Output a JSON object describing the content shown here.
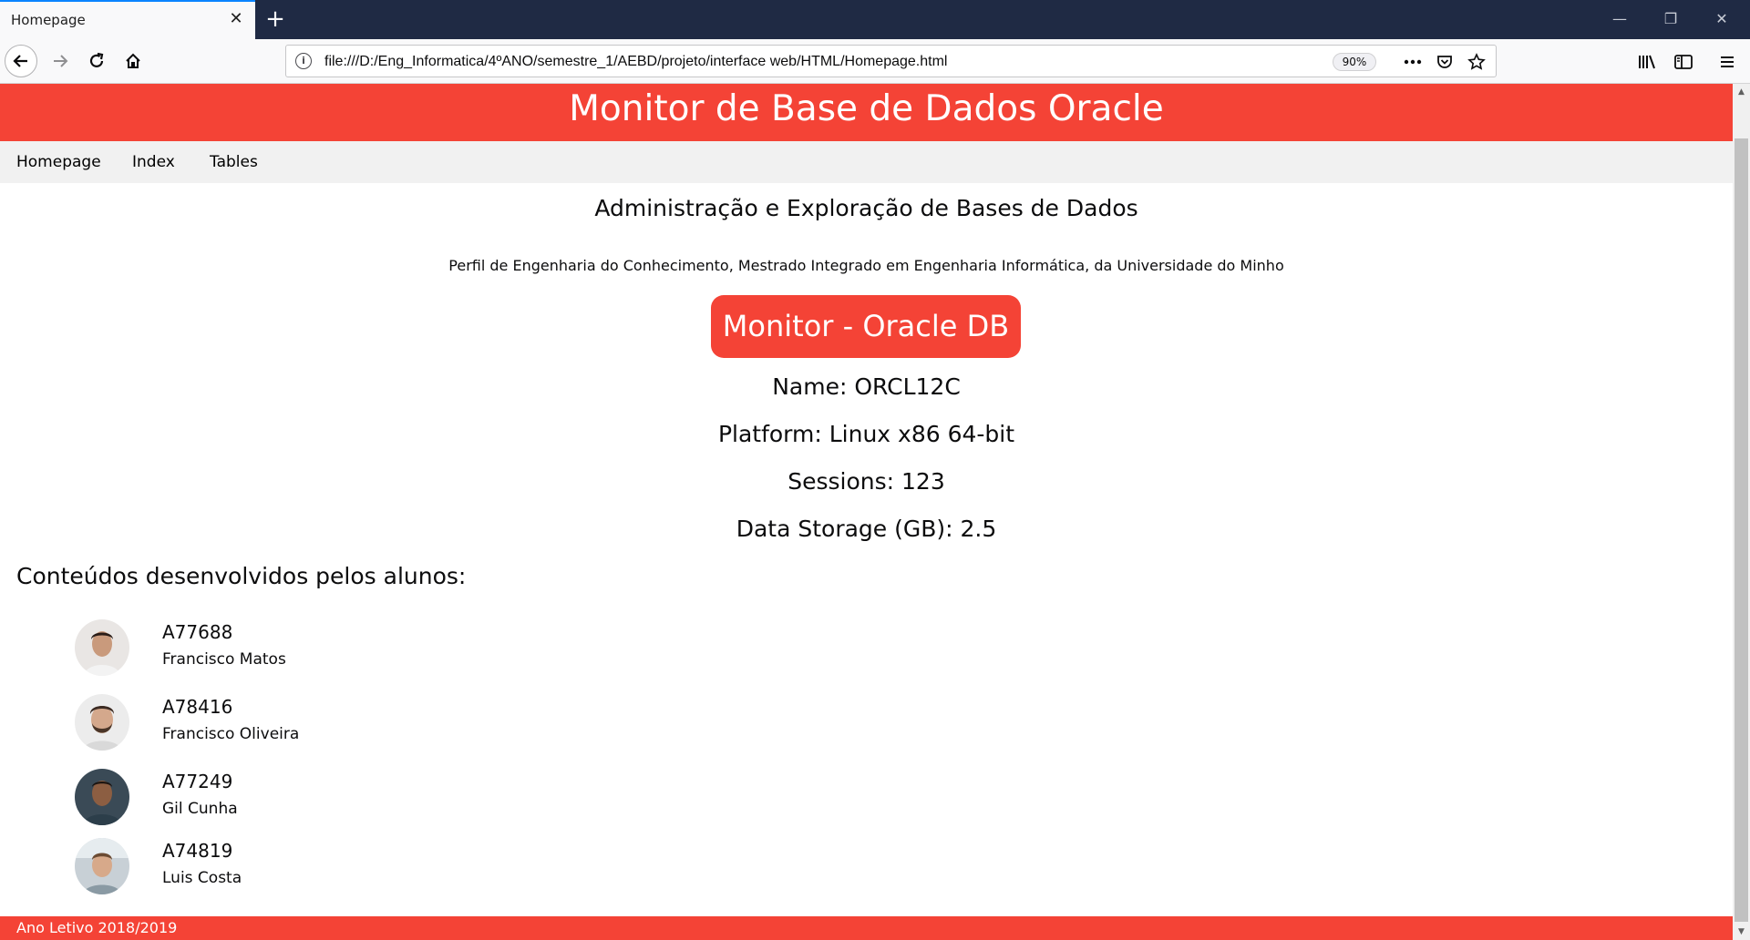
{
  "browser": {
    "tab_title": "Homepage",
    "url": "file:///D:/Eng_Informatica/4ºANO/semestre_1/AEBD/projeto/interface web/HTML/Homepage.html",
    "zoom": "90%"
  },
  "site": {
    "header_title": "Monitor de Base de Dados Oracle",
    "nav": [
      "Homepage",
      "Index",
      "Tables"
    ],
    "subtitle": "Administração e Exploração de Bases de Dados",
    "profile": "Perfil de Engenharia do Conhecimento, Mestrado Integrado em Engenharia Informática, da Universidade do Minho",
    "monitor_button": "Monitor - Oracle DB",
    "info": [
      "Name: ORCL12C",
      "Platform: Linux x86 64-bit",
      "Sessions: 123",
      "Data Storage (GB): 2.5"
    ],
    "students_title": "Conteúdos desenvolvidos pelos alunos:",
    "students": [
      {
        "id": "A77688",
        "name": "Francisco Matos"
      },
      {
        "id": "A78416",
        "name": "Francisco Oliveira"
      },
      {
        "id": "A77249",
        "name": "Gil Cunha"
      },
      {
        "id": "A74819",
        "name": "Luis Costa"
      }
    ],
    "footer": "Ano Letivo 2018/2019"
  },
  "colors": {
    "accent": "#f44336",
    "nav_bg": "#f1f1f1",
    "tabbar_bg": "#1f2a44"
  }
}
